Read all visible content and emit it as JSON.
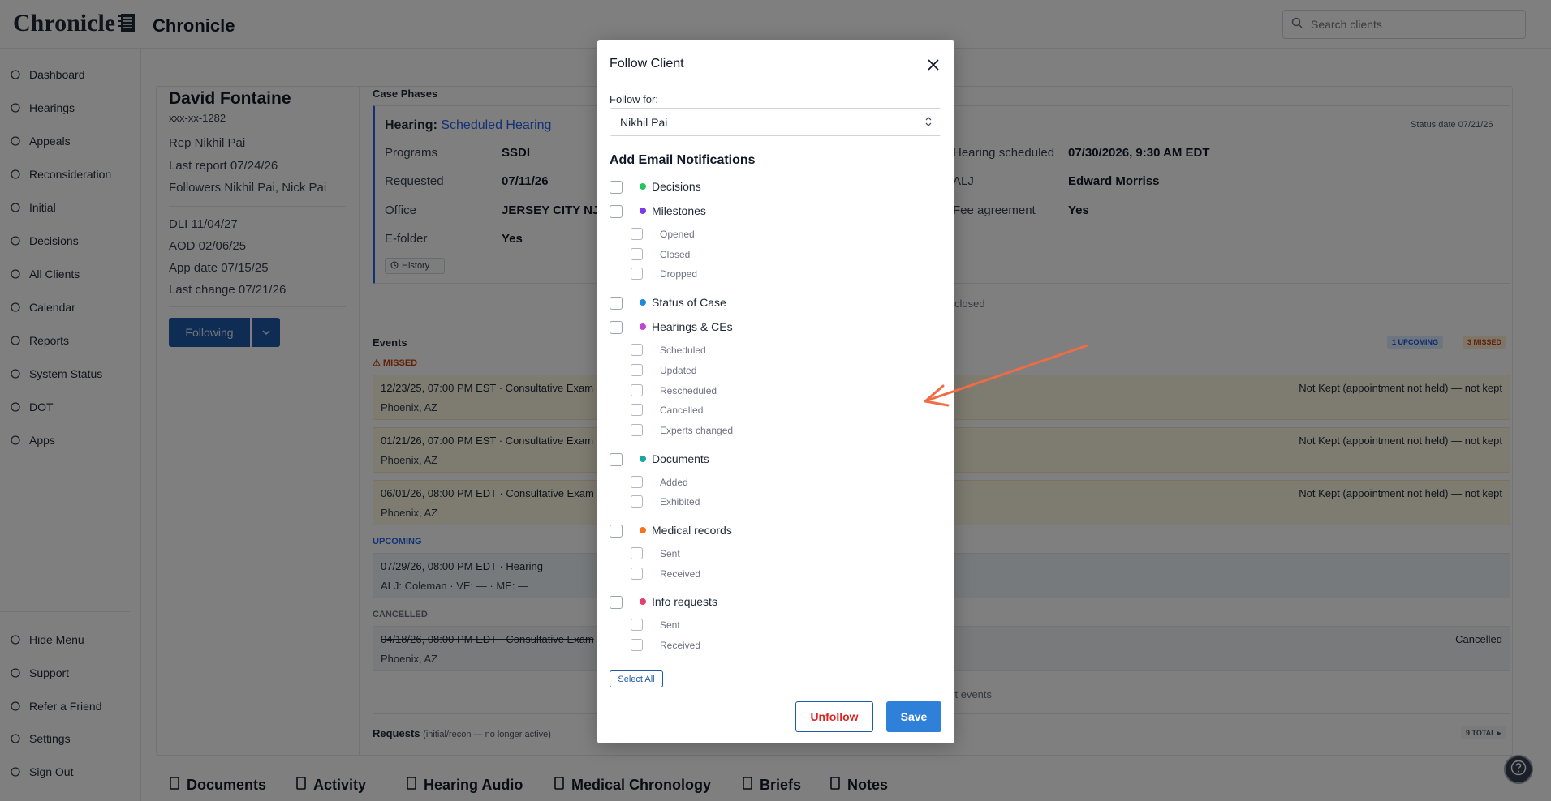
{
  "app": {
    "logo_text": "Chronicle",
    "title": "Chronicle"
  },
  "search": {
    "placeholder": "Search clients"
  },
  "sidebar": {
    "items": [
      {
        "label": "Dashboard",
        "icon": "dashboard-icon"
      },
      {
        "label": "Hearings",
        "icon": "hearings-icon"
      },
      {
        "label": "Appeals",
        "icon": "appeals-icon"
      },
      {
        "label": "Reconsideration",
        "icon": "reconsideration-icon"
      },
      {
        "label": "Initial",
        "icon": "initial-icon"
      },
      {
        "label": "Decisions",
        "icon": "flag-icon"
      },
      {
        "label": "All Clients",
        "icon": "users-icon"
      },
      {
        "label": "Calendar",
        "icon": "calendar-icon"
      },
      {
        "label": "Reports",
        "icon": "bar-chart-icon"
      },
      {
        "label": "System Status",
        "icon": "server-icon"
      },
      {
        "label": "DOT",
        "icon": "book-icon"
      },
      {
        "label": "Apps",
        "icon": "apps-icon"
      }
    ],
    "bottom_items": [
      {
        "label": "Hide Menu",
        "icon": "hide-menu-icon"
      },
      {
        "label": "Support",
        "icon": "support-icon"
      },
      {
        "label": "Refer a Friend",
        "icon": "mail-icon"
      },
      {
        "label": "Settings",
        "icon": "gear-icon"
      },
      {
        "label": "Sign Out",
        "icon": "sign-out-icon"
      }
    ]
  },
  "client": {
    "name": "David Fontaine",
    "ssn": "xxx-xx-1282",
    "rep": "Rep Nikhil Pai",
    "last_report": "Last report 07/24/26",
    "followers": "Followers Nikhil Pai, Nick Pai",
    "dli": "DLI 11/04/27",
    "aod": "AOD 02/06/25",
    "app_date": "App date 07/15/25",
    "last_change": "Last change 07/21/26",
    "following_label": "Following"
  },
  "case_phases": {
    "title": "Case Phases",
    "phase_label": "Hearing:",
    "phase_value": "Scheduled Hearing",
    "status_date": "Status date 07/21/26",
    "left": [
      {
        "k": "Programs",
        "v": "SSDI"
      },
      {
        "k": "Requested",
        "v": "07/11/26"
      },
      {
        "k": "Office",
        "v": "JERSEY CITY NJ"
      },
      {
        "k": "E-folder",
        "v": "Yes"
      }
    ],
    "right": [
      {
        "k": "Hearing scheduled",
        "v": "07/30/2026, 9:30 AM EDT"
      },
      {
        "k": "ALJ",
        "v": "Edward Morriss"
      },
      {
        "k": "Fee agreement",
        "v": "Yes"
      }
    ],
    "history_label": "History",
    "closed_text": "closed"
  },
  "events": {
    "title": "Events",
    "upcoming_badge": "1 UPCOMING",
    "missed_badge": "3 MISSED",
    "missed_label": "MISSED",
    "upcoming_label": "UPCOMING",
    "cancelled_label": "CANCELLED",
    "missed": [
      {
        "line1": "12/23/25, 07:00 PM EST · Consultative Exam",
        "line2": "Phoenix, AZ",
        "status": "Not Kept (appointment not held) — not kept"
      },
      {
        "line1": "01/21/26, 07:00 PM EST · Consultative Exam",
        "line2": "Phoenix, AZ",
        "status": "Not Kept (appointment not held) — not kept"
      },
      {
        "line1": "06/01/26, 08:00 PM EDT · Consultative Exam",
        "line2": "Phoenix, AZ",
        "status": "Not Kept (appointment not held) — not kept"
      }
    ],
    "upcoming": [
      {
        "line1": "07/29/26, 08:00 PM EDT · Hearing",
        "line2": "ALJ: Coleman · VE: — · ME: —"
      }
    ],
    "cancelled": [
      {
        "line1": "04/18/26, 08:00 PM EDT · Consultative Exam",
        "line2": "Phoenix, AZ",
        "status": "Cancelled"
      }
    ],
    "past_events_text": "st events"
  },
  "requests": {
    "title": "Requests",
    "note": "(initial/recon — no longer active)",
    "total_badge": "9 TOTAL ▸"
  },
  "bottom_tabs": [
    {
      "label": "Documents",
      "icon": "document-icon"
    },
    {
      "label": "Activity",
      "icon": "activity-icon"
    },
    {
      "label": "Hearing Audio",
      "icon": "music-icon"
    },
    {
      "label": "Medical Chronology",
      "icon": "medical-icon"
    },
    {
      "label": "Briefs",
      "icon": "pen-icon"
    },
    {
      "label": "Notes",
      "icon": "note-icon"
    }
  ],
  "modal": {
    "title": "Follow Client",
    "follow_for_label": "Follow for:",
    "follow_for_value": "Nikhil Pai",
    "section_title": "Add Email Notifications",
    "categories": [
      {
        "label": "Decisions",
        "color": "#22c55e",
        "subs": []
      },
      {
        "label": "Milestones",
        "color": "#7c3aed",
        "subs": [
          "Opened",
          "Closed",
          "Dropped"
        ]
      },
      {
        "label": "Status of Case",
        "color": "#1d8bd8",
        "subs": []
      },
      {
        "label": "Hearings & CEs",
        "color": "#c044d6",
        "subs": [
          "Scheduled",
          "Updated",
          "Rescheduled",
          "Cancelled",
          "Experts changed"
        ]
      },
      {
        "label": "Documents",
        "color": "#14a8a0",
        "subs": [
          "Added",
          "Exhibited"
        ]
      },
      {
        "label": "Medical records",
        "color": "#f97316",
        "subs": [
          "Sent",
          "Received"
        ]
      },
      {
        "label": "Info requests",
        "color": "#e53e6c",
        "subs": [
          "Sent",
          "Received"
        ]
      }
    ],
    "select_all_label": "Select All",
    "unfollow_label": "Unfollow",
    "save_label": "Save"
  },
  "colors": {
    "primary": "#1e5aa8",
    "save": "#2f80d8",
    "danger": "#dc2626",
    "arrow": "#ef6c45"
  }
}
